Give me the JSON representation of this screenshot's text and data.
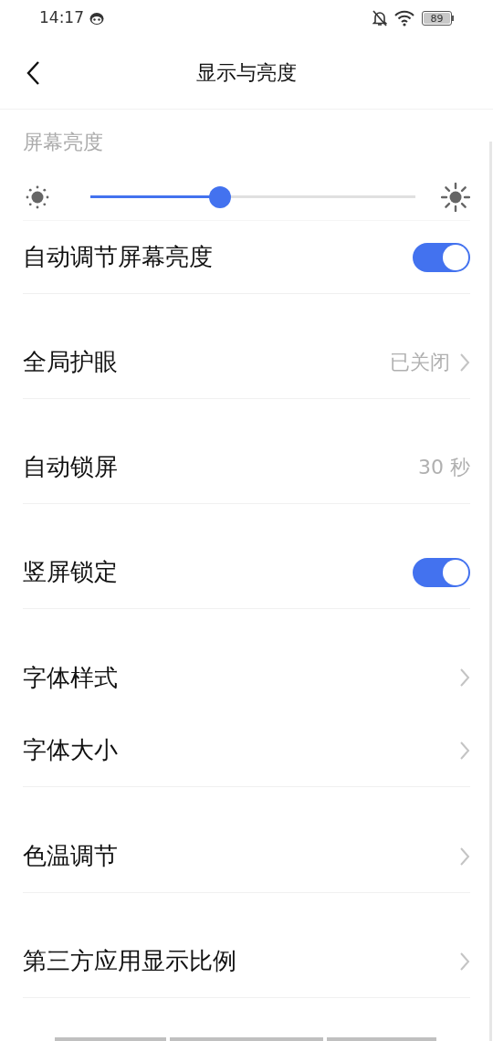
{
  "status_bar": {
    "time": "14:17",
    "battery": "89"
  },
  "header": {
    "title": "显示与亮度"
  },
  "brightness": {
    "label": "屏幕亮度",
    "level": 0.4
  },
  "rows": [
    {
      "kind": "toggle",
      "label": "自动调节屏幕亮度",
      "on": true,
      "divider": true
    },
    {
      "kind": "link",
      "label": "全局护眼",
      "value": "已关闭",
      "divider": true
    },
    {
      "kind": "value",
      "label": "自动锁屏",
      "value": "30 秒",
      "divider": true
    },
    {
      "kind": "toggle",
      "label": "竖屏锁定",
      "on": true,
      "divider": true
    },
    {
      "kind": "link",
      "label": "字体样式",
      "divider": false
    },
    {
      "kind": "link",
      "label": "字体大小",
      "divider": true
    },
    {
      "kind": "link",
      "label": "色温调节",
      "divider": true
    },
    {
      "kind": "link",
      "label": "第三方应用显示比例",
      "divider": true
    }
  ]
}
